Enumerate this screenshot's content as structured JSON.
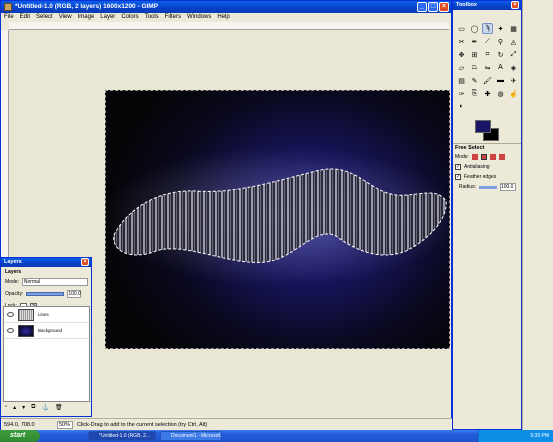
{
  "main_window": {
    "title": "*Untitled-1.0 (RGB, 2 layers) 1600x1200 - GIMP",
    "menu": [
      "File",
      "Edit",
      "Select",
      "View",
      "Image",
      "Layer",
      "Colors",
      "Tools",
      "Filters",
      "Windows",
      "Help"
    ],
    "status": {
      "coords": "594.0, 708.0",
      "zoom": "50%",
      "hint": "Click-Drag to add to the current selection (try Ctrl, Alt)"
    }
  },
  "layers_dock": {
    "title": "Layers",
    "tab": "Layers",
    "mode_label": "Mode:",
    "mode_value": "Normal",
    "opacity_label": "Opacity:",
    "opacity_value": "100.0",
    "lock_label": "Lock:",
    "layers": [
      {
        "name": "Lines"
      },
      {
        "name": "Background"
      }
    ]
  },
  "toolbox": {
    "title": "Toolbox",
    "tool_options_title": "Free Select",
    "mode_label": "Mode:",
    "antialiasing_label": "Antialiasing",
    "feather_label": "Feather edges",
    "radius_label": "Radius:",
    "radius_value": "100.0",
    "fg_color": "#1a1466",
    "bg_color": "#000000"
  },
  "taskbar": {
    "start_label": "start",
    "tasks": [
      "*Untitled-1.0 (RGB, 2...",
      "Document1 - Microsof..."
    ],
    "clock": "9:39 PM"
  }
}
